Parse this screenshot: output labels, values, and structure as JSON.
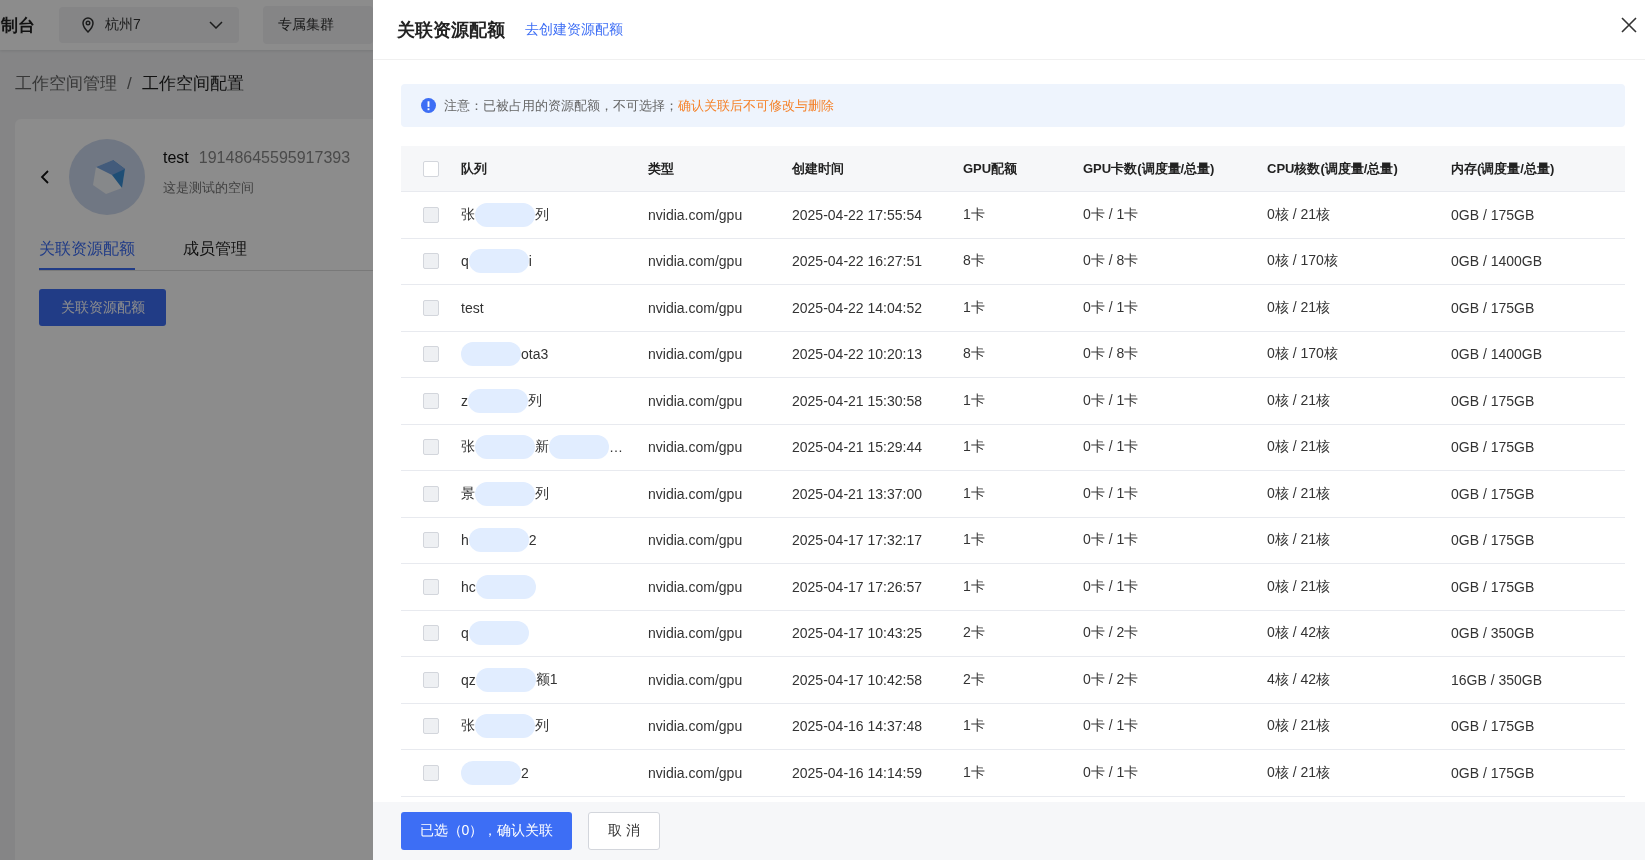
{
  "background_page": {
    "console_title": "制台",
    "region_select": {
      "value": "杭州7"
    },
    "cluster_button": "专属集群",
    "breadcrumb": [
      "工作空间管理",
      "工作空间配置"
    ],
    "breadcrumb_separator": "/",
    "workspace": {
      "name": "test",
      "id": "19148645595917393",
      "description": "这是测试的空间"
    },
    "tabs": [
      {
        "label": "关联资源配额",
        "selected": true
      },
      {
        "label": "成员管理",
        "selected": false
      }
    ],
    "action_button": "关联资源配额"
  },
  "drawer": {
    "title": "关联资源配额",
    "create_link": "去创建资源配额",
    "notice": {
      "text": "注意：已被占用的资源配额，不可选择；",
      "warning": "确认关联后不可修改与删除"
    },
    "table": {
      "select_all": {
        "checked": false
      },
      "columns": [
        "队列",
        "类型",
        "创建时间",
        "GPU配额",
        "GPU卡数(调度量/总量)",
        "CPU核数(调度量/总量)",
        "内存(调度量/总量)"
      ],
      "rows": [
        {
          "checked": false,
          "disabled": true,
          "queue": [
            {
              "kind": "text",
              "text": "张"
            },
            {
              "kind": "redacted"
            },
            {
              "kind": "text",
              "text": "列"
            }
          ],
          "type": "nvidia.com/gpu",
          "created": "2025-04-22 17:55:54",
          "gpu_quota": "1卡",
          "gpu_cards": "0卡 / 1卡",
          "cpu_cores": "0核 / 21核",
          "memory": "0GB / 175GB"
        },
        {
          "checked": false,
          "disabled": true,
          "queue": [
            {
              "kind": "text",
              "text": "q"
            },
            {
              "kind": "redacted"
            },
            {
              "kind": "text",
              "text": "i"
            }
          ],
          "type": "nvidia.com/gpu",
          "created": "2025-04-22 16:27:51",
          "gpu_quota": "8卡",
          "gpu_cards": "0卡 / 8卡",
          "cpu_cores": "0核 / 170核",
          "memory": "0GB / 1400GB"
        },
        {
          "checked": false,
          "disabled": true,
          "queue": [
            {
              "kind": "text",
              "text": "test"
            }
          ],
          "type": "nvidia.com/gpu",
          "created": "2025-04-22 14:04:52",
          "gpu_quota": "1卡",
          "gpu_cards": "0卡 / 1卡",
          "cpu_cores": "0核 / 21核",
          "memory": "0GB / 175GB"
        },
        {
          "checked": false,
          "disabled": true,
          "queue": [
            {
              "kind": "redacted"
            },
            {
              "kind": "text",
              "text": "ota3"
            }
          ],
          "type": "nvidia.com/gpu",
          "created": "2025-04-22 10:20:13",
          "gpu_quota": "8卡",
          "gpu_cards": "0卡 / 8卡",
          "cpu_cores": "0核 / 170核",
          "memory": "0GB / 1400GB"
        },
        {
          "checked": false,
          "disabled": true,
          "queue": [
            {
              "kind": "text",
              "text": "z"
            },
            {
              "kind": "redacted"
            },
            {
              "kind": "text",
              "text": "列"
            }
          ],
          "type": "nvidia.com/gpu",
          "created": "2025-04-21 15:30:58",
          "gpu_quota": "1卡",
          "gpu_cards": "0卡 / 1卡",
          "cpu_cores": "0核 / 21核",
          "memory": "0GB / 175GB"
        },
        {
          "checked": false,
          "disabled": true,
          "queue": [
            {
              "kind": "text",
              "text": "张"
            },
            {
              "kind": "redacted"
            },
            {
              "kind": "text",
              "text": "新"
            },
            {
              "kind": "redacted"
            },
            {
              "kind": "text",
              "text": "…"
            }
          ],
          "type": "nvidia.com/gpu",
          "created": "2025-04-21 15:29:44",
          "gpu_quota": "1卡",
          "gpu_cards": "0卡 / 1卡",
          "cpu_cores": "0核 / 21核",
          "memory": "0GB / 175GB"
        },
        {
          "checked": false,
          "disabled": true,
          "queue": [
            {
              "kind": "text",
              "text": "景"
            },
            {
              "kind": "redacted"
            },
            {
              "kind": "text",
              "text": "列"
            }
          ],
          "type": "nvidia.com/gpu",
          "created": "2025-04-21 13:37:00",
          "gpu_quota": "1卡",
          "gpu_cards": "0卡 / 1卡",
          "cpu_cores": "0核 / 21核",
          "memory": "0GB / 175GB"
        },
        {
          "checked": false,
          "disabled": true,
          "queue": [
            {
              "kind": "text",
              "text": "h"
            },
            {
              "kind": "redacted"
            },
            {
              "kind": "text",
              "text": "2"
            }
          ],
          "type": "nvidia.com/gpu",
          "created": "2025-04-17 17:32:17",
          "gpu_quota": "1卡",
          "gpu_cards": "0卡 / 1卡",
          "cpu_cores": "0核 / 21核",
          "memory": "0GB / 175GB"
        },
        {
          "checked": false,
          "disabled": true,
          "queue": [
            {
              "kind": "text",
              "text": "hc"
            },
            {
              "kind": "redacted"
            }
          ],
          "type": "nvidia.com/gpu",
          "created": "2025-04-17 17:26:57",
          "gpu_quota": "1卡",
          "gpu_cards": "0卡 / 1卡",
          "cpu_cores": "0核 / 21核",
          "memory": "0GB / 175GB"
        },
        {
          "checked": false,
          "disabled": true,
          "queue": [
            {
              "kind": "text",
              "text": "q"
            },
            {
              "kind": "redacted"
            }
          ],
          "type": "nvidia.com/gpu",
          "created": "2025-04-17 10:43:25",
          "gpu_quota": "2卡",
          "gpu_cards": "0卡 / 2卡",
          "cpu_cores": "0核 / 42核",
          "memory": "0GB / 350GB"
        },
        {
          "checked": false,
          "disabled": true,
          "queue": [
            {
              "kind": "text",
              "text": "qz"
            },
            {
              "kind": "redacted"
            },
            {
              "kind": "text",
              "text": "额1"
            }
          ],
          "type": "nvidia.com/gpu",
          "created": "2025-04-17 10:42:58",
          "gpu_quota": "2卡",
          "gpu_cards": "0卡 / 2卡",
          "cpu_cores": "4核 / 42核",
          "memory": "16GB / 350GB"
        },
        {
          "checked": false,
          "disabled": true,
          "queue": [
            {
              "kind": "text",
              "text": "张"
            },
            {
              "kind": "redacted"
            },
            {
              "kind": "text",
              "text": "列"
            }
          ],
          "type": "nvidia.com/gpu",
          "created": "2025-04-16 14:37:48",
          "gpu_quota": "1卡",
          "gpu_cards": "0卡 / 1卡",
          "cpu_cores": "0核 / 21核",
          "memory": "0GB / 175GB"
        },
        {
          "checked": false,
          "disabled": true,
          "queue": [
            {
              "kind": "redacted"
            },
            {
              "kind": "text",
              "text": "2"
            }
          ],
          "type": "nvidia.com/gpu",
          "created": "2025-04-16 14:14:59",
          "gpu_quota": "1卡",
          "gpu_cards": "0卡 / 1卡",
          "cpu_cores": "0核 / 21核",
          "memory": "0GB / 175GB"
        }
      ]
    },
    "confirm_button": "已选（0），确认关联",
    "cancel_button": "取 消"
  }
}
